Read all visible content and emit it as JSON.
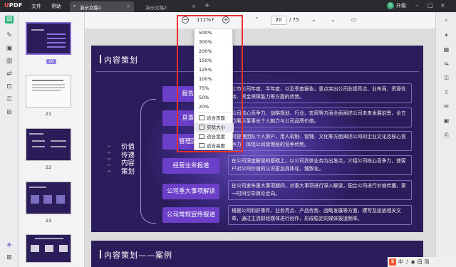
{
  "app": {
    "brand": "UPDF",
    "menu": [
      "文件",
      "帮助"
    ],
    "tabs": [
      {
        "label": "演示文稿1",
        "active": true
      },
      {
        "label": "演示文稿2",
        "active": false
      }
    ],
    "user_label": "升级",
    "user_initial": "S"
  },
  "toolbar": {
    "zoom": "111%",
    "page_current": "20",
    "page_total": "/ 75"
  },
  "zoom_menu": {
    "levels": [
      "500%",
      "300%",
      "200%",
      "150%",
      "125%",
      "100%",
      "75%",
      "50%",
      "20%"
    ],
    "fit_options": [
      "适合页面",
      "实际大小",
      "适合宽度",
      "适合高度"
    ],
    "highlighted": "实际大小"
  },
  "thumbnails": {
    "current_page_badge": "20",
    "labels": [
      "21",
      "22",
      "23"
    ]
  },
  "slide": {
    "title": "内容策划",
    "vertical_title": [
      "价值",
      "传递",
      "内容",
      "策划"
    ],
    "vertical_number": "1 2 0 1 9",
    "items": [
      {
        "label": "报告解",
        "desc": "上市公司年度、半年度、以及季度报告，重点突出公司业绩亮点、业布局、资源优势、资金保障能力等方面的优势。"
      },
      {
        "label": "亘事长",
        "desc": "公司核心竞争力、战略规划、行业、宏观等方面全面阐述公司未来发展前景，全方位展示董事长个人魅力与公司品牌价值。"
      },
      {
        "label": "管理团队",
        "desc": "司管理团队个人资产，用人机制、管理、文化等方面阐述公司的企业文化及核心竞争力，体现公司管理层的竞争优势。"
      },
      {
        "label": "经营业务报道",
        "desc": "在公司深度解读的基础上，以公司具体业务为出发点，介绍公司核心竞争力，使客户对公司价值的认识更加具体化、细致化。"
      },
      {
        "label": "公司重大事项解读",
        "desc": "在公司发布重大事项期间，对重大事项进行深入解读，配合公司进行价值传播，第一时间引导舆论走向。"
      },
      {
        "label": "公司常规宣传报道",
        "desc": "根据公司利好事件、业务亮点、产品优势、战略发展等方面，撰写及投放相关文章，通过主流财经媒体进行创作，形成稳定的媒体报道频率。"
      }
    ]
  },
  "slide2": {
    "title": "内容策划——案例"
  },
  "taskbar": {
    "items": [
      "中",
      "♪",
      "◉",
      "田",
      "简"
    ]
  },
  "colors": {
    "slide_bg": "#2b1d5c",
    "item_button": "#6b3fc8",
    "highlight_box": "#e8302c",
    "accent": "#7e6bd8"
  }
}
